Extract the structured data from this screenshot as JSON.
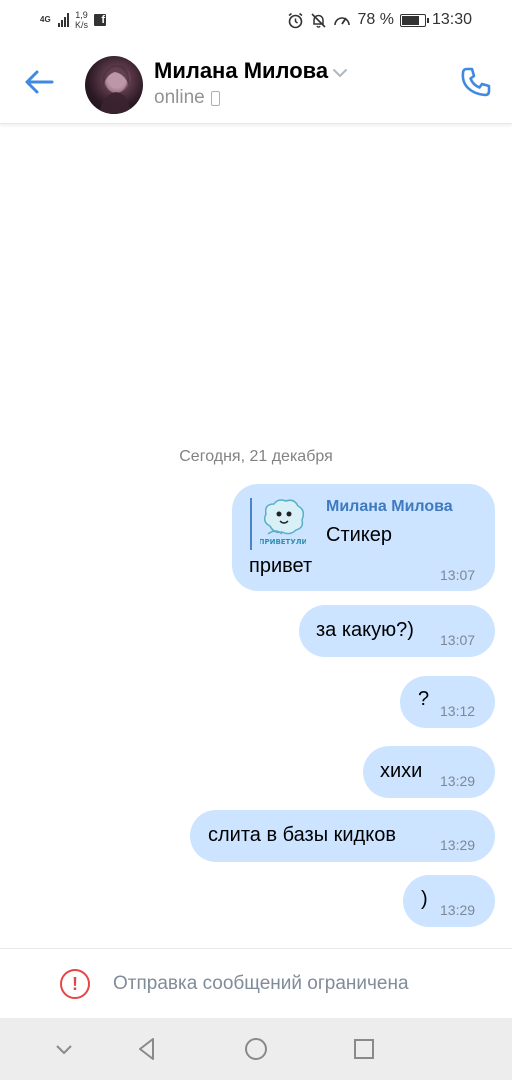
{
  "status_bar": {
    "network_type": "4G",
    "speed_value": "1,9",
    "speed_unit": "K/s",
    "fb_label": "f",
    "battery": "78 %",
    "battery_level": 0.78,
    "time": "13:30"
  },
  "header": {
    "contact_name": "Милана Милова",
    "status": "online"
  },
  "chat": {
    "date_separator": "Сегодня, 21 декабря",
    "messages": [
      {
        "reply_author": "Милана Милова",
        "reply_text": "Стикер",
        "sticker_caption": "ПРИВЕТУЛИ",
        "text": "привет",
        "time": "13:07"
      },
      {
        "text": "за какую?)",
        "time": "13:07"
      },
      {
        "text": "?",
        "time": "13:12"
      },
      {
        "text": "хихи",
        "time": "13:29"
      },
      {
        "text": "слита в базы кидков",
        "time": "13:29"
      },
      {
        "text": ")",
        "time": "13:29"
      }
    ]
  },
  "footer": {
    "restriction_text": "Отправка сообщений ограничена",
    "warning_symbol": "!"
  },
  "colors": {
    "accent": "#3f8ae0",
    "bubble": "#cce4ff",
    "warning": "#e64646"
  }
}
